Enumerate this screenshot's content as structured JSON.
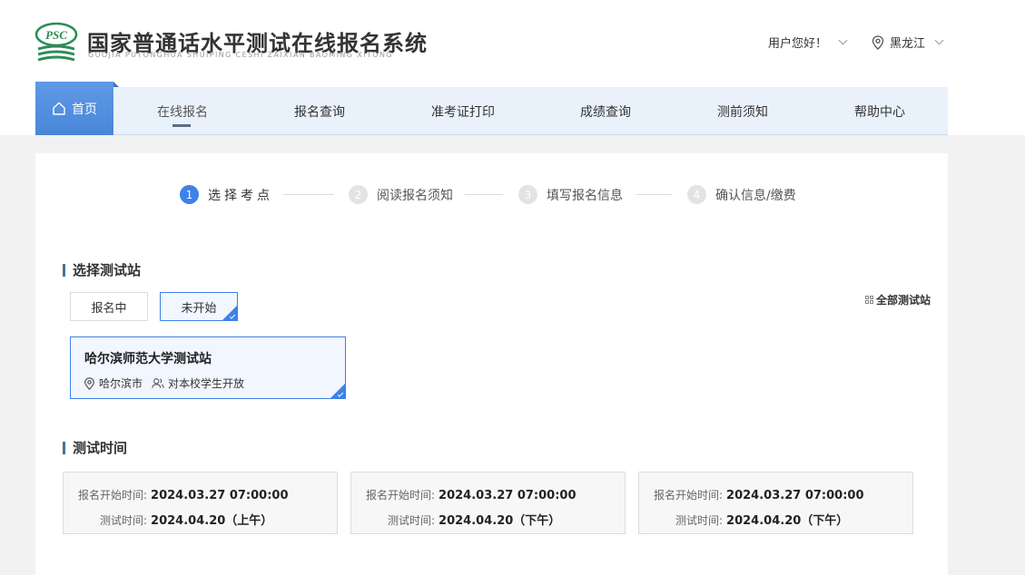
{
  "header": {
    "logo_text": "PSC",
    "title": "国家普通话水平测试在线报名系统",
    "subtitle": "GUOJIA PUTONGHUA SHUIPING CESHI ZAIXIAN BAOMING XITONG",
    "greeting": "用户您好！",
    "region": "黑龙江"
  },
  "nav": {
    "home": "首页",
    "items": [
      "在线报名",
      "报名查询",
      "准考证打印",
      "成绩查询",
      "测前须知",
      "帮助中心"
    ]
  },
  "steps": [
    {
      "num": "1",
      "label": "选择考点"
    },
    {
      "num": "2",
      "label": "阅读报名须知"
    },
    {
      "num": "3",
      "label": "填写报名信息"
    },
    {
      "num": "4",
      "label": "确认信息/缴费"
    }
  ],
  "station_section": {
    "title": "选择测试站",
    "tabs": [
      "报名中",
      "未开始"
    ],
    "all_sites": "全部测试站",
    "site": {
      "name": "哈尔滨师范大学测试站",
      "city": "哈尔滨市",
      "open_to": "对本校学生开放"
    }
  },
  "time_section": {
    "title": "测试时间",
    "reg_label": "报名开始时间:",
    "test_label": "测试时间:",
    "slots": [
      {
        "reg_start": "2024.03.27 07:00:00",
        "test_time": "2024.04.20（上午）"
      },
      {
        "reg_start": "2024.03.27 07:00:00",
        "test_time": "2024.04.20（下午）"
      },
      {
        "reg_start": "2024.03.27 07:00:00",
        "test_time": "2024.04.20（下午）"
      }
    ]
  },
  "colors": {
    "accent": "#3d82e8",
    "nav_bg": "#e9f1fb",
    "logo_green": "#2e8b57"
  }
}
